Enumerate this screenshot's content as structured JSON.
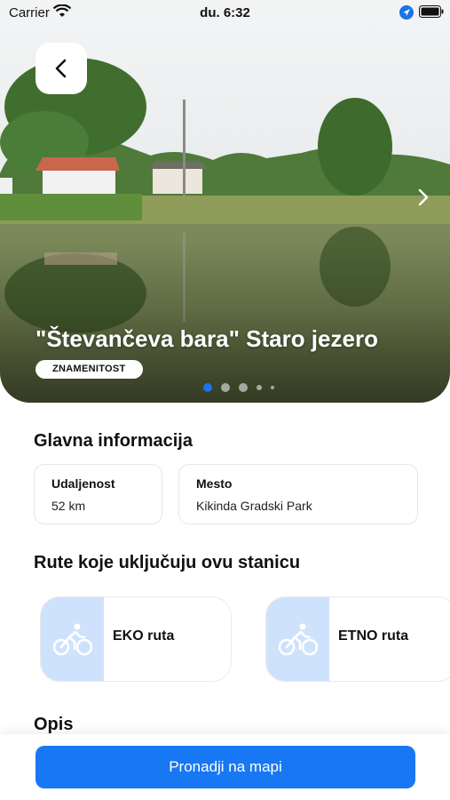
{
  "status_bar": {
    "carrier": "Carrier",
    "time": "du. 6:32"
  },
  "hero": {
    "title": "\"Števančeva bara\" Staro jezero",
    "badge": "ZNAMENITOST",
    "slide_index": 1
  },
  "main_info": {
    "heading": "Glavna informacija",
    "distance_label": "Udaljenost",
    "distance_value": "52 km",
    "place_label": "Mesto",
    "place_value": "Kikinda Gradski Park"
  },
  "routes": {
    "heading": "Rute koje uključuju ovu stanicu",
    "items": [
      {
        "label": "EKO ruta",
        "icon": "bicycle-icon"
      },
      {
        "label": "ETNO ruta",
        "icon": "bicycle-icon"
      }
    ]
  },
  "description": {
    "heading": "Opis"
  },
  "action": {
    "button_label": "Pronadji na mapi"
  },
  "colors": {
    "accent": "#1877f2",
    "route_icon_bg": "#cfe2fb",
    "dot_active": "#1a73e8"
  }
}
